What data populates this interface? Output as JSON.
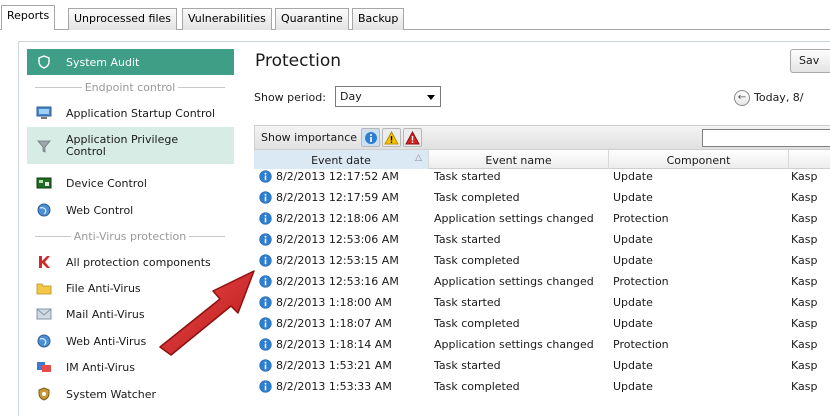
{
  "tabs": [
    {
      "label": "Reports",
      "active": true
    },
    {
      "label": "Unprocessed files",
      "active": false
    },
    {
      "label": "Vulnerabilities",
      "active": false
    },
    {
      "label": "Quarantine",
      "active": false
    },
    {
      "label": "Backup",
      "active": false
    }
  ],
  "sidebar": {
    "system_audit": {
      "label": "System Audit",
      "icon": "shield-icon"
    },
    "sections": {
      "endpoint": "Endpoint control",
      "antivirus": "Anti-Virus protection"
    },
    "items": [
      {
        "label": "Application Startup Control",
        "icon": "monitor-icon"
      },
      {
        "label": "Application Privilege Control",
        "icon": "funnel-icon",
        "selected": true
      },
      {
        "label": "Device Control",
        "icon": "circuit-board-icon"
      },
      {
        "label": "Web Control",
        "icon": "globe-icon"
      },
      {
        "label": "All protection components",
        "icon": "kaspersky-k-icon"
      },
      {
        "label": "File Anti-Virus",
        "icon": "folder-icon"
      },
      {
        "label": "Mail Anti-Virus",
        "icon": "envelope-icon"
      },
      {
        "label": "Web Anti-Virus",
        "icon": "globe-icon"
      },
      {
        "label": "IM Anti-Virus",
        "icon": "chat-icon"
      },
      {
        "label": "System Watcher",
        "icon": "shield-badge-icon"
      }
    ]
  },
  "main": {
    "title": "Protection",
    "save_label": "Sav",
    "period_label": "Show period:",
    "period_value": "Day",
    "date_range": "Today, 8/",
    "importance_label": "Show importance",
    "filter_value": "",
    "columns": [
      "Event date",
      "Event name",
      "Component",
      ""
    ],
    "rows": [
      {
        "date": "8/2/2013 12:17:52 AM",
        "event": "Task started",
        "component": "Update",
        "source": "Kasp"
      },
      {
        "date": "8/2/2013 12:17:59 AM",
        "event": "Task completed",
        "component": "Update",
        "source": "Kasp"
      },
      {
        "date": "8/2/2013 12:18:06 AM",
        "event": "Application settings changed",
        "component": "Protection",
        "source": "Kasp"
      },
      {
        "date": "8/2/2013 12:53:06 AM",
        "event": "Task started",
        "component": "Update",
        "source": "Kasp"
      },
      {
        "date": "8/2/2013 12:53:15 AM",
        "event": "Task completed",
        "component": "Update",
        "source": "Kasp"
      },
      {
        "date": "8/2/2013 12:53:16 AM",
        "event": "Application settings changed",
        "component": "Protection",
        "source": "Kasp"
      },
      {
        "date": "8/2/2013 1:18:00 AM",
        "event": "Task started",
        "component": "Update",
        "source": "Kasp"
      },
      {
        "date": "8/2/2013 1:18:07 AM",
        "event": "Task completed",
        "component": "Update",
        "source": "Kasp"
      },
      {
        "date": "8/2/2013 1:18:14 AM",
        "event": "Application settings changed",
        "component": "Protection",
        "source": "Kasp"
      },
      {
        "date": "8/2/2013 1:53:21 AM",
        "event": "Task started",
        "component": "Update",
        "source": "Kasp"
      },
      {
        "date": "8/2/2013 1:53:33 AM",
        "event": "Task completed",
        "component": "Update",
        "source": "Kasp"
      }
    ]
  },
  "colors": {
    "accent_green": "#3f9e86",
    "selected_bg": "#d7ece5",
    "info_blue": "#2f7fd1",
    "warning_yellow": "#f5c400",
    "critical_red": "#d42424",
    "arrow_red": "#d42a2a"
  }
}
